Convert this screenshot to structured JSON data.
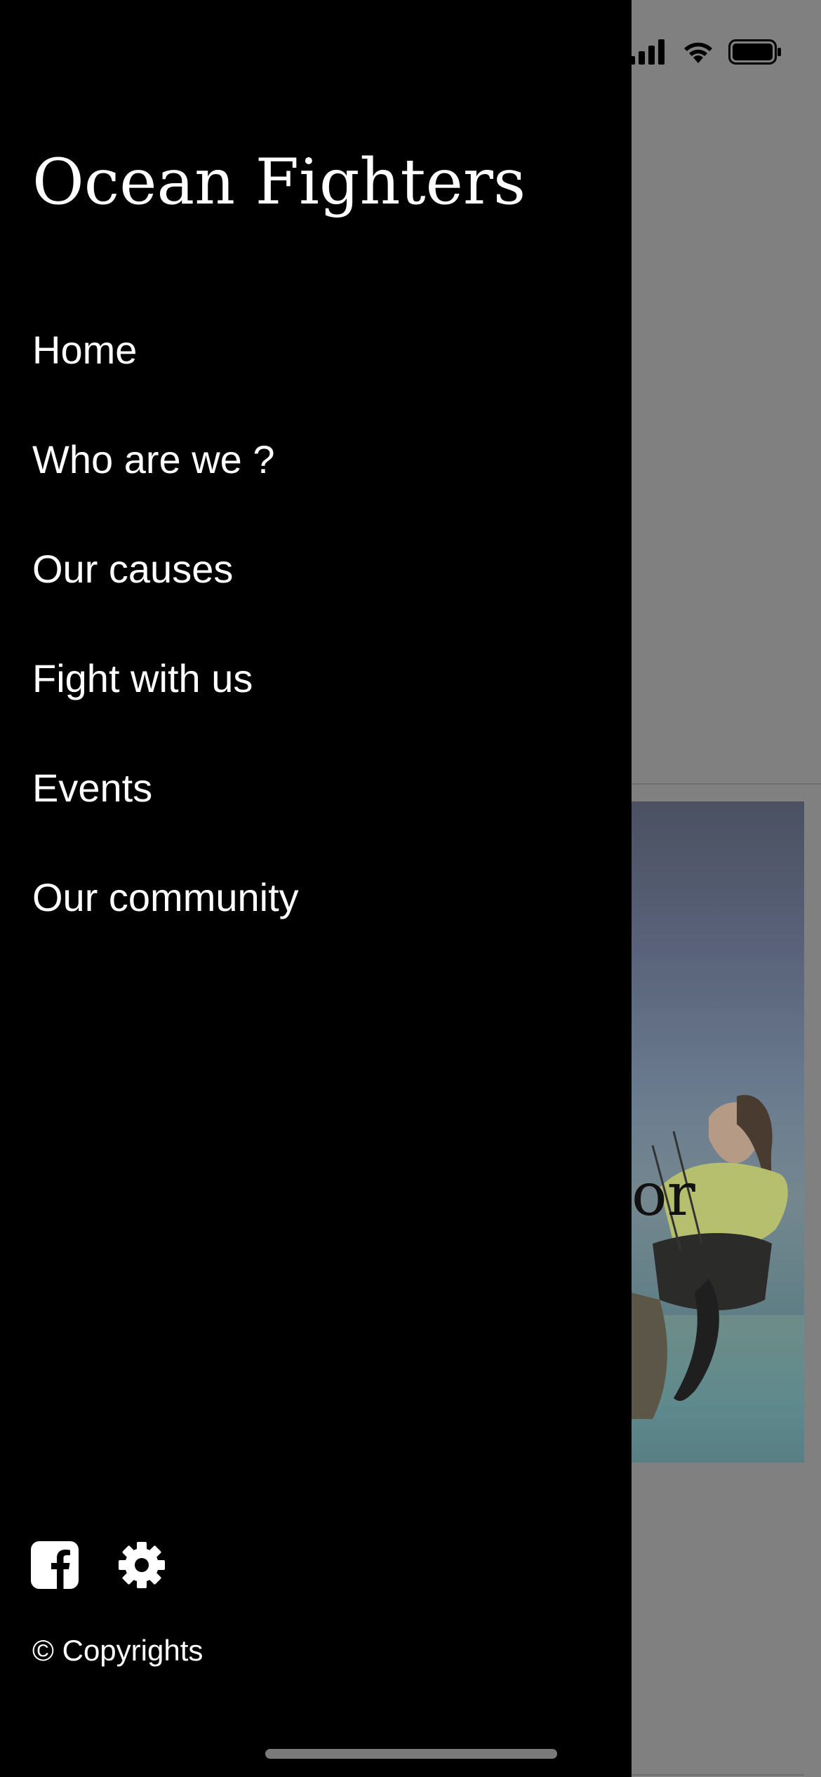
{
  "drawer": {
    "title": "Ocean Fighters",
    "nav_items": [
      {
        "label": "Home"
      },
      {
        "label": "Who are we ?"
      },
      {
        "label": "Our causes"
      },
      {
        "label": "Fight with us"
      },
      {
        "label": "Events"
      },
      {
        "label": "Our community"
      }
    ],
    "social_icons": [
      "facebook-icon",
      "settings-gear-icon"
    ],
    "copyright": "© Copyrights"
  },
  "background_page": {
    "hero_text_fragment": "or"
  },
  "status_bar": {
    "icons": [
      "cellular-signal-icon",
      "wifi-icon",
      "battery-icon"
    ]
  },
  "colors": {
    "drawer_bg": "#000000",
    "drawer_text": "#ffffff",
    "overlay_dim": "#808080"
  }
}
